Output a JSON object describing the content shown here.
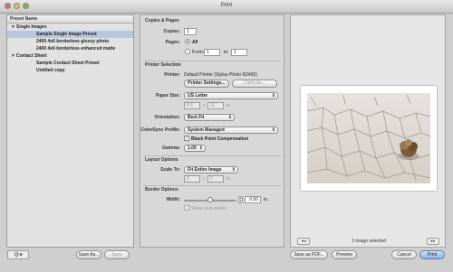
{
  "window": {
    "title": "Print"
  },
  "presets": {
    "header": "Preset Name",
    "items": [
      {
        "label": "Single Images",
        "kind": "group",
        "expanded": true,
        "selected": true
      },
      {
        "label": "Sample Single Image Preset",
        "kind": "child",
        "selected": true
      },
      {
        "label": "2400 4x6 borderless glossy photo",
        "kind": "child",
        "selected": false
      },
      {
        "label": "2400 4x6 borderless enhanced matte",
        "kind": "child",
        "selected": false
      },
      {
        "label": "Contact Sheet",
        "kind": "group",
        "expanded": true,
        "selected": false
      },
      {
        "label": "Sample Contact Sheet Preset",
        "kind": "child",
        "selected": false
      },
      {
        "label": "Untitled copy",
        "kind": "child",
        "selected": false
      }
    ],
    "gear_icon": "gear-icon",
    "save_as_label": "Save As...",
    "save_label": "Save"
  },
  "copies_pages": {
    "title": "Copies & Pages",
    "copies_label": "Copies:",
    "copies_value": "1",
    "pages_label": "Pages:",
    "all_label": "All",
    "from_label": "From:",
    "from_value": "1",
    "to_label": "to:",
    "to_value": "1"
  },
  "printer_selection": {
    "title": "Printer Selection",
    "printer_label": "Printer:",
    "printer_value": "Default Printer (Stylus Photo R2400)",
    "printer_settings_label": "Printer Settings...",
    "calibrate_label": "Calibrate...",
    "paper_size_label": "Paper Size:",
    "paper_size_value": "US Letter",
    "paper_w": "8.5",
    "paper_x": "x",
    "paper_h": "11",
    "paper_unit": "in.",
    "orientation_label": "Orientation:",
    "orientation_value": "Best Fit",
    "colorsync_label": "ColorSync Profile:",
    "colorsync_value": "System Managed",
    "bpc_label": "Black Point Compensation",
    "gamma_label": "Gamma:",
    "gamma_value": "1.00"
  },
  "layout_options": {
    "title": "Layout Options",
    "scale_label": "Scale To:",
    "scale_value": "Fit Entire Image",
    "dim_w": "8",
    "dim_x": "x",
    "dim_h": "6",
    "dim_unit": "in."
  },
  "border_options": {
    "title": "Border Options",
    "width_label": "Width:",
    "width_value": "0.50",
    "width_unit": "in.",
    "slider_fraction": 0.5,
    "crop_marks_label": "Show crop marks"
  },
  "preview": {
    "count_label": "1 image selected",
    "prev_icon": "arrow-left-icon",
    "next_icon": "arrow-right-icon"
  },
  "footer": {
    "save_pdf_label": "Save as PDF...",
    "preview_label": "Preview",
    "cancel_label": "Cancel",
    "print_label": "Print"
  },
  "colors": {
    "accent": "#2a5db0",
    "selection": "#b7c7dd",
    "window": "#cfcfcf"
  }
}
